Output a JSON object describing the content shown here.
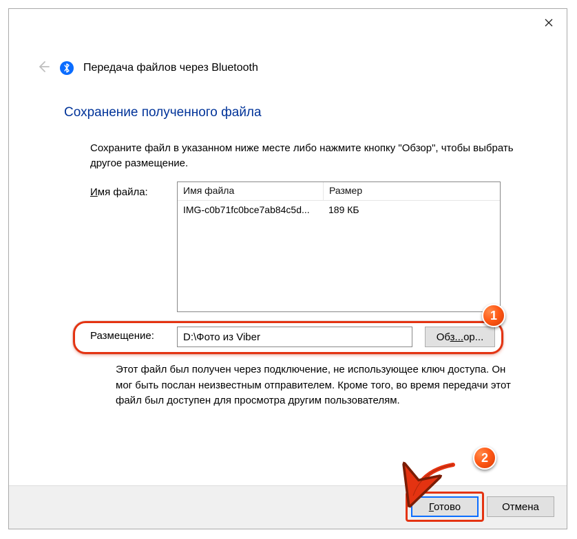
{
  "window": {
    "header_title": "Передача файлов через Bluetooth",
    "page_title": "Сохранение полученного файла",
    "instruction": "Сохраните файл в указанном ниже месте либо нажмите кнопку \"Обзор\", чтобы выбрать другое размещение.",
    "filelist_label": "Имя файла:",
    "columns": {
      "name": "Имя файла",
      "size": "Размер"
    },
    "files": [
      {
        "name": "IMG-c0b71fc0bce7ab84c5d...",
        "size": "189 КБ"
      }
    ],
    "location_label": "Размещение:",
    "location_value": "D:\\Фото из Viber",
    "browse_label": "Обзор",
    "warning": "Этот файл был получен через подключение, не использующее ключ доступа. Он мог быть послан неизвестным отправителем.  Кроме того, во время передачи этот файл был доступен для просмотра другим пользователям.",
    "done_label": "Готово",
    "cancel_label": "Отмена"
  },
  "annotations": {
    "badge1": "1",
    "badge2": "2",
    "highlight_color": "#e43311"
  }
}
